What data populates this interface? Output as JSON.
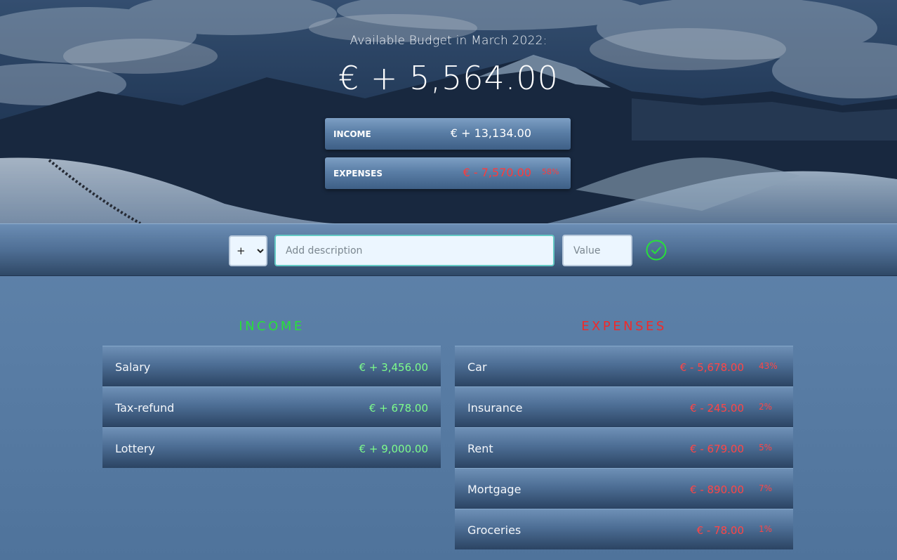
{
  "header": {
    "budget_title": "Available Budget in March 2022:",
    "budget_value": "€ + 5,564.00",
    "income_label": "INCOME",
    "income_value": "€ + 13,134.00",
    "expenses_label": "EXPENSES",
    "expenses_value": "€ - 7,570.00",
    "expenses_percentage": "58%"
  },
  "add_form": {
    "type_options": [
      "+",
      "-"
    ],
    "type_selected": "+",
    "description_placeholder": "Add description",
    "description_value": "",
    "value_placeholder": "Value",
    "value_value": "",
    "submit_icon": "checkmark-circle-icon"
  },
  "income": {
    "title": "INCOME",
    "items": [
      {
        "description": "Salary",
        "value": "€ + 3,456.00"
      },
      {
        "description": "Tax-refund",
        "value": "€ + 678.00"
      },
      {
        "description": "Lottery",
        "value": "€ + 9,000.00"
      }
    ]
  },
  "expenses": {
    "title": "EXPENSES",
    "items": [
      {
        "description": "Car",
        "value": "€ - 5,678.00",
        "percentage": "43%"
      },
      {
        "description": "Insurance",
        "value": "€ - 245.00",
        "percentage": "2%"
      },
      {
        "description": "Rent",
        "value": "€ - 679.00",
        "percentage": "5%"
      },
      {
        "description": "Mortgage",
        "value": "€ - 890.00",
        "percentage": "7%"
      },
      {
        "description": "Groceries",
        "value": "€ - 78.00",
        "percentage": "1%"
      }
    ]
  },
  "colors": {
    "income_accent": "#28e03a",
    "expenses_accent": "#f02a2a",
    "submit_accent": "#28e03a"
  }
}
